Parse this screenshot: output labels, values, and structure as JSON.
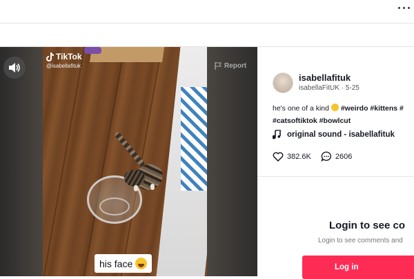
{
  "video": {
    "watermark_brand": "TikTok",
    "watermark_handle": "@isabellafituk",
    "report_label": "Report",
    "caption_text": "his face"
  },
  "post": {
    "username": "isabellafituk",
    "subline": "isabellaFitUK · 5-25",
    "desc_text": "he's one of a kind",
    "hashtags_line1": "#weirdo #kittens #",
    "hashtags_line2": "#catsoftiktok #bowlcut",
    "sound": "original sound - isabellafituk",
    "likes": "382.6K",
    "comments": "2606"
  },
  "login": {
    "title": "Login to see co",
    "subtitle": "Login to see comments and",
    "button_label": "Log in"
  },
  "colors": {
    "accent": "#fe2c55",
    "text": "#161823",
    "report": "#a9a9a9"
  },
  "icons": [
    "more-icon",
    "volume-icon",
    "tiktok-logo-icon",
    "flag-icon",
    "music-note-icon",
    "heart-icon",
    "comment-icon",
    "laughing-emoji",
    "emoji-icon"
  ]
}
